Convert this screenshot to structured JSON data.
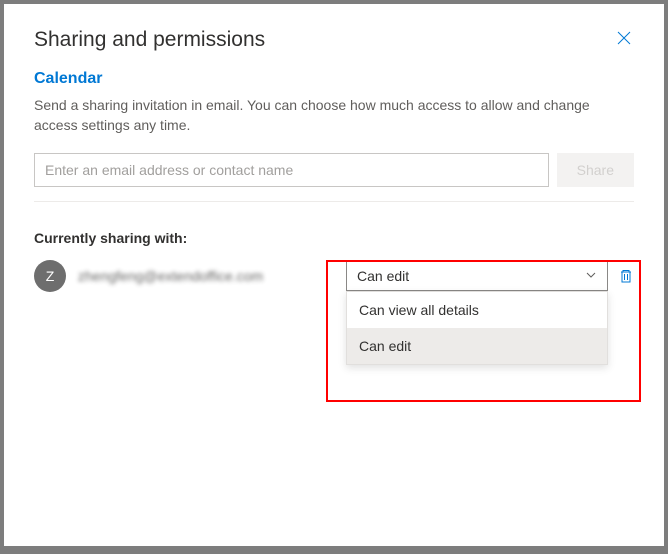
{
  "dialog": {
    "title": "Sharing and permissions",
    "subtitle": "Calendar",
    "description": "Send a sharing invitation in email. You can choose how much access to allow and change access settings any time.",
    "input_placeholder": "Enter an email address or contact name",
    "share_label": "Share",
    "section_heading": "Currently sharing with:"
  },
  "shared": {
    "avatar_initial": "Z",
    "contact_display": "zhengfeng@extendoffice.com",
    "permission_selected": "Can edit",
    "permission_options": [
      "Can view all details",
      "Can edit"
    ]
  }
}
